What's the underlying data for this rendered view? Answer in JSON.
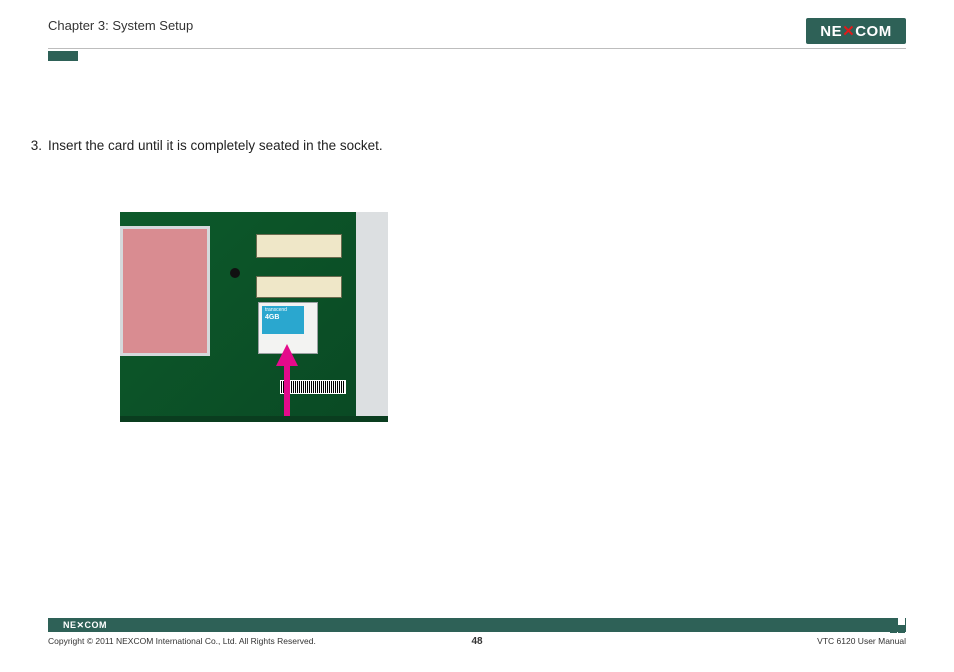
{
  "header": {
    "chapter": "Chapter 3: System Setup",
    "logo_text": "NE COM"
  },
  "step": {
    "number": "3.",
    "text": "Insert the card until it is completely seated in the socket."
  },
  "photo": {
    "cf_brand": "transcend",
    "cf_capacity": "4GB"
  },
  "footer": {
    "logo_text": "NE COM",
    "copyright": "Copyright © 2011 NEXCOM International Co., Ltd. All Rights Reserved.",
    "page_number": "48",
    "manual": "VTC 6120 User Manual"
  }
}
